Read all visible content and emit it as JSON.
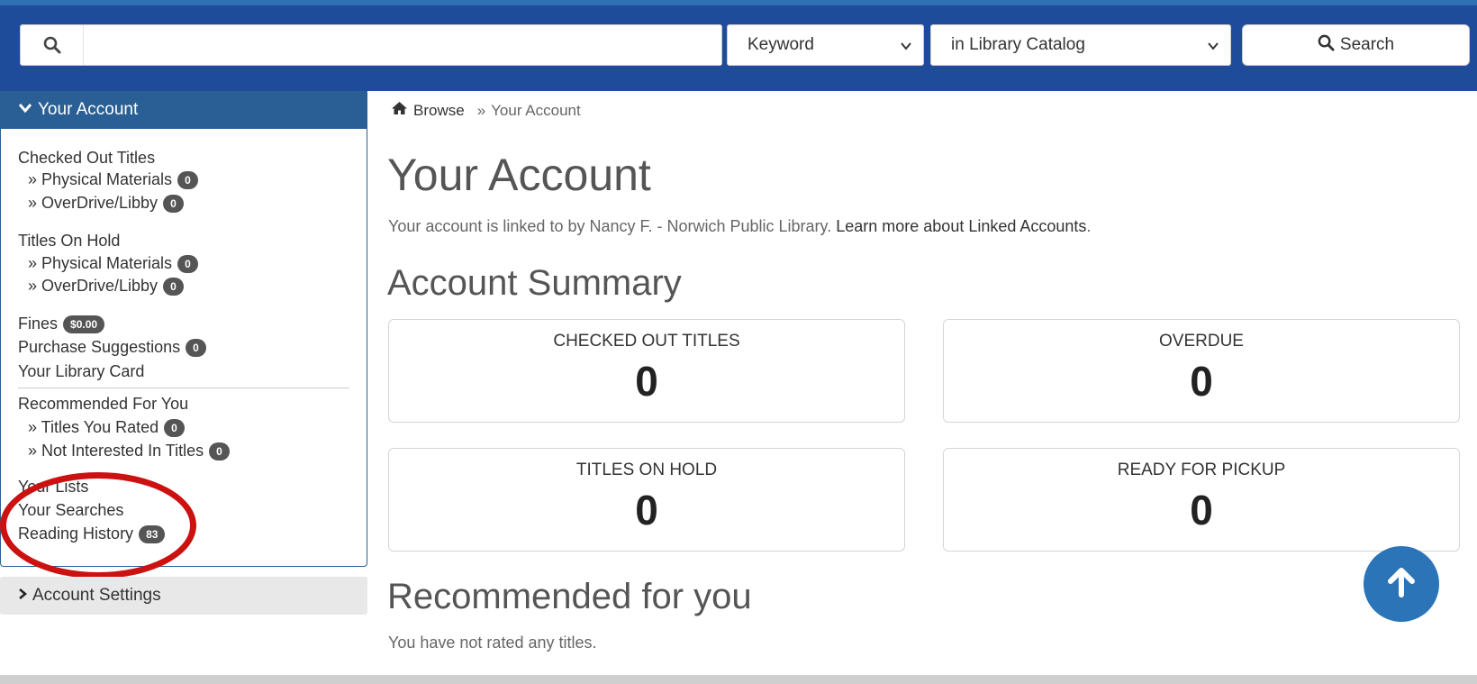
{
  "search": {
    "placeholder": "",
    "type_selected": "Keyword",
    "scope_selected": "in Library Catalog",
    "button_label": "Search"
  },
  "sidebar": {
    "header": "Your Account",
    "checked_out": {
      "label": "Checked Out Titles",
      "physical_label": "» Physical Materials",
      "physical_count": "0",
      "overdrive_label": "» OverDrive/Libby",
      "overdrive_count": "0"
    },
    "holds": {
      "label": "Titles On Hold",
      "physical_label": "» Physical Materials",
      "physical_count": "0",
      "overdrive_label": "» OverDrive/Libby",
      "overdrive_count": "0"
    },
    "fines_label": "Fines",
    "fines_amount": "$0.00",
    "purchase_label": "Purchase Suggestions",
    "purchase_count": "0",
    "library_card_label": "Your Library Card",
    "recommended_label": "Recommended For You",
    "rated_label": "» Titles You Rated",
    "rated_count": "0",
    "not_interested_label": "» Not Interested In Titles",
    "not_interested_count": "0",
    "lists_label": "Your Lists",
    "searches_label": "Your Searches",
    "history_label": "Reading History",
    "history_count": "83",
    "settings_label": "Account Settings"
  },
  "breadcrumb": {
    "home": "Browse",
    "sep": "»",
    "current": "Your Account"
  },
  "main": {
    "title": "Your Account",
    "linked_text": "Your account is linked to by Nancy F. - Norwich Public Library.",
    "linked_link": "Learn more about Linked Accounts",
    "linked_period": ".",
    "summary_title": "Account Summary",
    "cards": [
      {
        "label": "CHECKED OUT TITLES",
        "value": "0"
      },
      {
        "label": "OVERDUE",
        "value": "0"
      },
      {
        "label": "TITLES ON HOLD",
        "value": "0"
      },
      {
        "label": "READY FOR PICKUP",
        "value": "0"
      }
    ],
    "recommended_title": "Recommended for you",
    "recommended_empty": "You have not rated any titles."
  },
  "colors": {
    "header_bg": "#1f4c9a",
    "sidebar_head_bg": "#2a5f95",
    "annotation_circle": "#cc1111",
    "scroll_button": "#2b74b8"
  },
  "icons": {
    "search": "search-icon",
    "home": "home-icon",
    "expand": "chevron-down-icon",
    "collapse": "chevron-right-icon",
    "back_to_top": "arrow-up-icon"
  }
}
